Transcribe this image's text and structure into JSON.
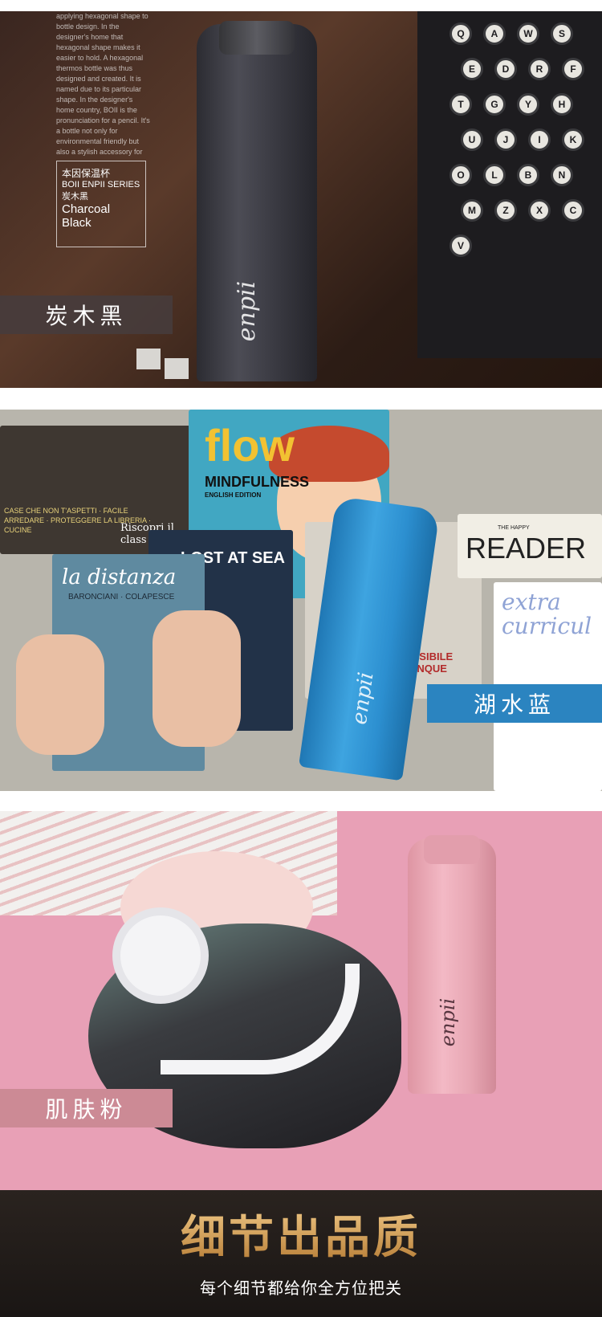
{
  "panel_charcoal": {
    "intro_text": "applying hexagonal shape to bottle design. In the designer's home that hexagonal shape makes it easier to hold. A hexagonal thermos bottle was thus designed and created. It is named due to its particular shape. In the designer's home country, BOII is the pronunciation for a pencil. It's a bottle not only for environmental friendly but also a stylish accessory for",
    "series_cn": "本因保温杯",
    "series_en": "BOII ENPII SERIES",
    "color_cn": "炭木黑",
    "color_en": "Charcoal Black",
    "label": "炭木黑",
    "bottle_logo": "enpii",
    "typewriter_keys": [
      "Q",
      "A",
      "W",
      "S",
      "E",
      "D",
      "R",
      "F",
      "T",
      "G",
      "Y",
      "H",
      "U",
      "J",
      "I",
      "K",
      "O",
      "L",
      "B",
      "N",
      "M",
      "Z",
      "X",
      "C",
      "V"
    ]
  },
  "panel_lake": {
    "flow_title": "flow",
    "flow_subtitle": "MINDFULNESS",
    "flow_edition": "ENGLISH EDITION",
    "left_mag_text": "CASE CHE NON T'ASPETTI · FACILE ARREDARE · PROTEGGERE LA LIBRERIA · CUCINE",
    "left_mag_title": "Riscopri il class",
    "lost_at_sea": "LOST AT SEA",
    "distanza_title": "la distanza",
    "distanza_authors": "BARONCIANI · COLAPESCE",
    "reader_small": "THE HAPPY",
    "reader_title": "READER",
    "extra_title": "extra curricul",
    "vis_text1": "NG",
    "vis_text2": "VISIBILE UNQUE",
    "label": "湖水蓝",
    "bottle_logo": "enpii"
  },
  "panel_pink": {
    "label": "肌肤粉",
    "bottle_logo": "enpii"
  },
  "quality": {
    "title": "细节出品质",
    "subtitle": "每个细节都给你全方位把关"
  },
  "colors": {
    "charcoal_label_bg": "#463c3c",
    "lake_label_bg": "#2b84c0",
    "pink_label_bg": "#cc8a95",
    "gold": "#d9a35a"
  }
}
